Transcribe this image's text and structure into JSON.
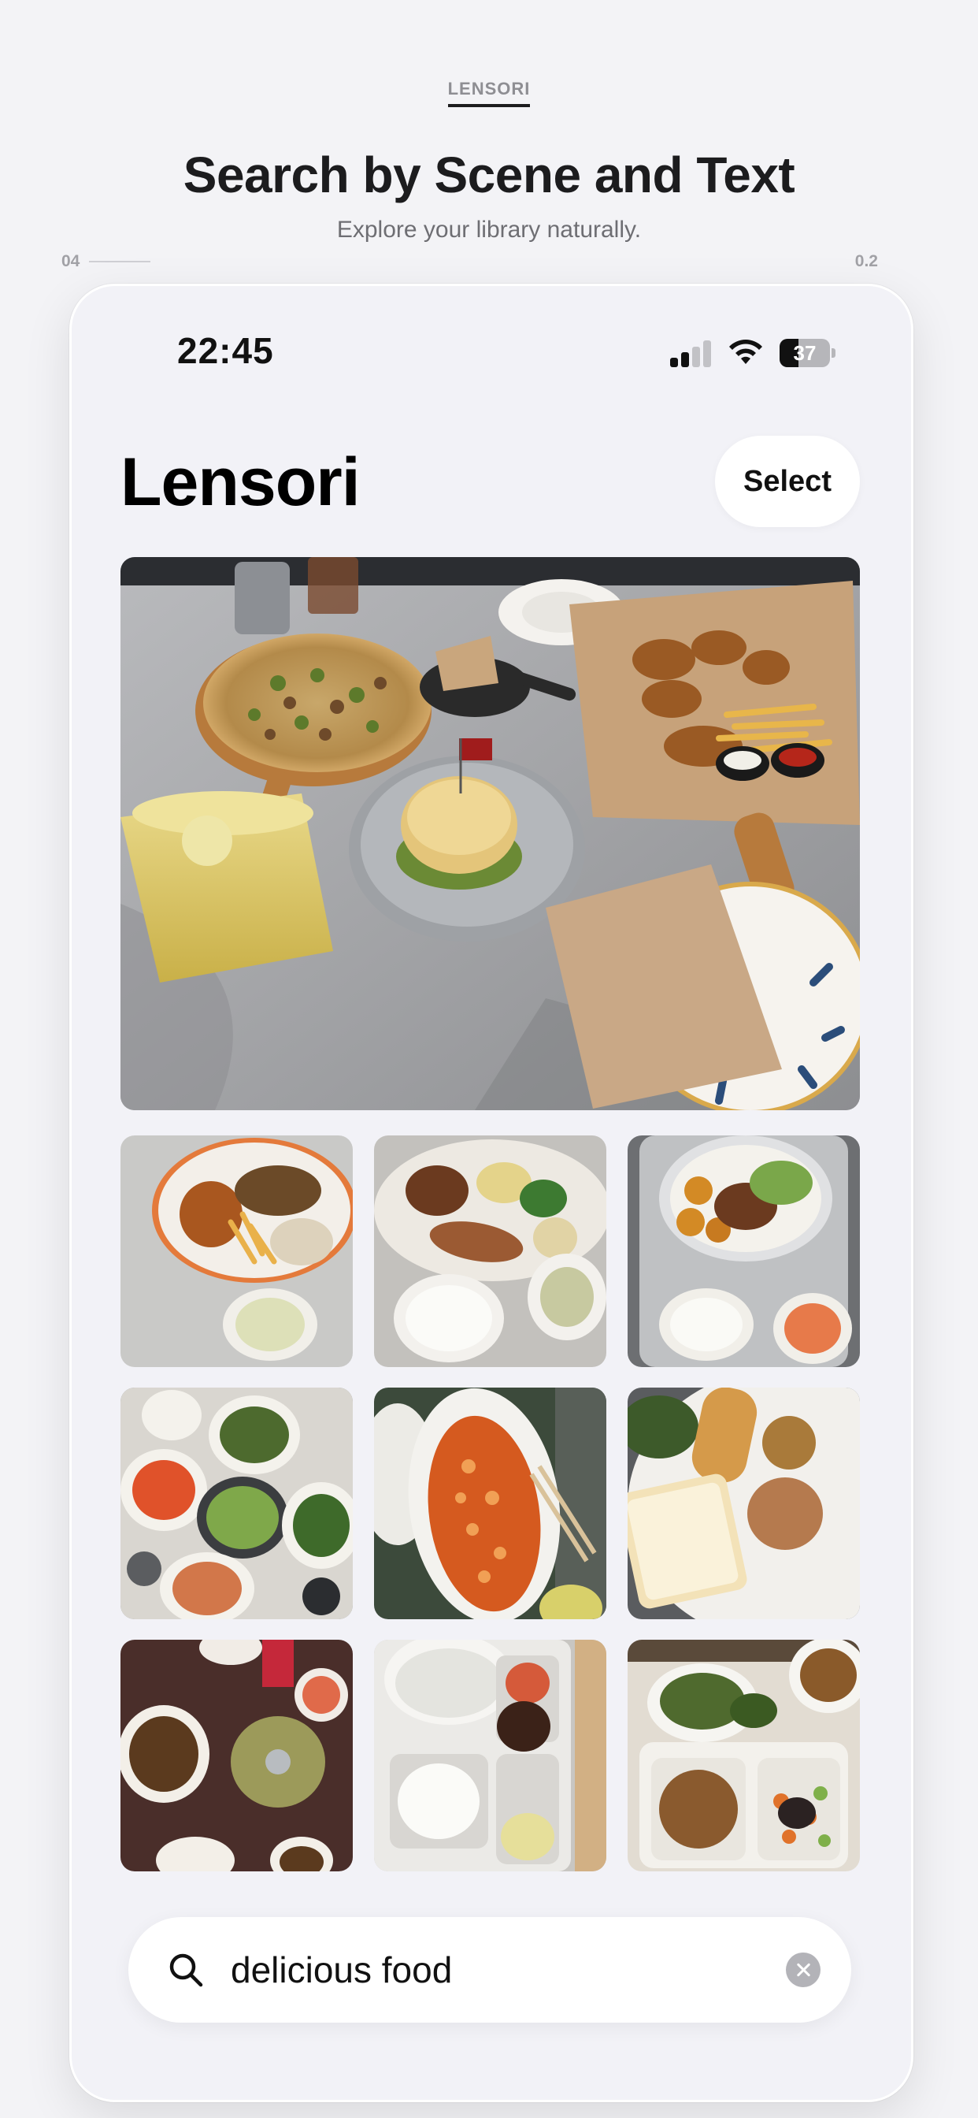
{
  "header": {
    "brand_tag": "LENSORI",
    "headline": "Search by Scene and Text",
    "subhead": "Explore your library naturally.",
    "corner_left": "04",
    "corner_right": "0.2"
  },
  "status_bar": {
    "time": "22:45",
    "battery": "37",
    "battery_level_percent": 37,
    "signal_bars_filled": 2,
    "signal_bars_total": 4
  },
  "app": {
    "title": "Lensori",
    "select_label": "Select"
  },
  "gallery": {
    "hero": {
      "content": "table with pizza, burger, fried chicken, fries and lemon drink"
    },
    "thumbnails": [
      {
        "content": "plate with chicken, fries, bread and soup"
      },
      {
        "content": "plate with sweet potato, egg, greens and rice bowl"
      },
      {
        "content": "plate with balls, salad, rice and soup"
      },
      {
        "content": "table with many dishes including edamame"
      },
      {
        "content": "fish with sauce"
      },
      {
        "content": "bread, toast and egg breakfast"
      },
      {
        "content": "dark table with several dishes"
      },
      {
        "content": "tray with porridge, rice and meat"
      },
      {
        "content": "tray with tofu and vegetables"
      }
    ]
  },
  "search": {
    "value": "delicious food",
    "placeholder": "Search"
  },
  "colors": {
    "background": "#f3f3f6",
    "phone_bg": "#f2f2f7",
    "text_primary": "#111111",
    "text_secondary": "#6e6e73"
  }
}
